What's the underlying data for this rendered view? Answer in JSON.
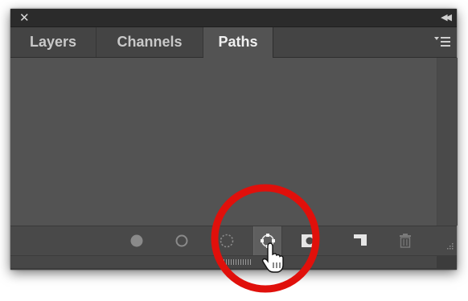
{
  "panel": {
    "titlebar": {
      "close_icon": "close-icon",
      "collapse_icon": "double-chevron-left-icon"
    },
    "tabs": [
      {
        "label": "Layers",
        "active": false
      },
      {
        "label": "Channels",
        "active": false
      },
      {
        "label": "Paths",
        "active": true
      }
    ],
    "menu_icon": "panel-menu-icon",
    "toolbar": {
      "buttons": [
        {
          "name": "fill-path",
          "icon": "filled-circle-icon"
        },
        {
          "name": "stroke-path",
          "icon": "circle-outline-icon"
        },
        {
          "name": "load-path-as-selection",
          "icon": "dashed-selection-icon"
        },
        {
          "name": "make-work-path-from-selection",
          "icon": "work-path-icon",
          "active": true
        },
        {
          "name": "add-mask",
          "icon": "mask-icon"
        },
        {
          "name": "create-new-path",
          "icon": "new-path-icon"
        },
        {
          "name": "delete-path",
          "icon": "trash-icon"
        }
      ]
    }
  },
  "annotation": {
    "highlight_color": "#e0100b",
    "cursor_icon": "hand-pointer-icon"
  },
  "colors": {
    "panel_bg": "#535353",
    "tab_strip": "#444444",
    "titlebar": "#2b2b2b"
  }
}
